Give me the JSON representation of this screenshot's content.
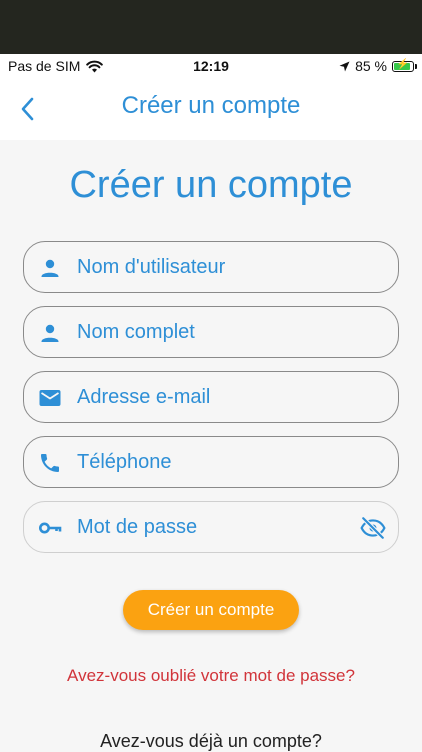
{
  "status_bar": {
    "carrier": "Pas de SIM",
    "time": "12:19",
    "battery": "85 %"
  },
  "nav": {
    "title": "Créer un compte"
  },
  "page": {
    "heading": "Créer un compte"
  },
  "form": {
    "username_placeholder": "Nom d'utilisateur",
    "fullname_placeholder": "Nom complet",
    "email_placeholder": "Adresse e-mail",
    "phone_placeholder": "Téléphone",
    "password_placeholder": "Mot de passe"
  },
  "actions": {
    "submit_label": "Créer un compte",
    "forgot_label": "Avez-vous oublié votre mot de passe?",
    "have_account_label": "Avez-vous déjà un compte?"
  },
  "icons": {
    "back": "chevron-left-icon",
    "username": "person-icon",
    "fullname": "person-icon",
    "email": "mail-icon",
    "phone": "phone-icon",
    "password": "key-icon",
    "visibility": "eye-off-icon"
  },
  "colors": {
    "accent": "#2e8fd6",
    "button": "#fba211",
    "link": "#d1343a"
  }
}
